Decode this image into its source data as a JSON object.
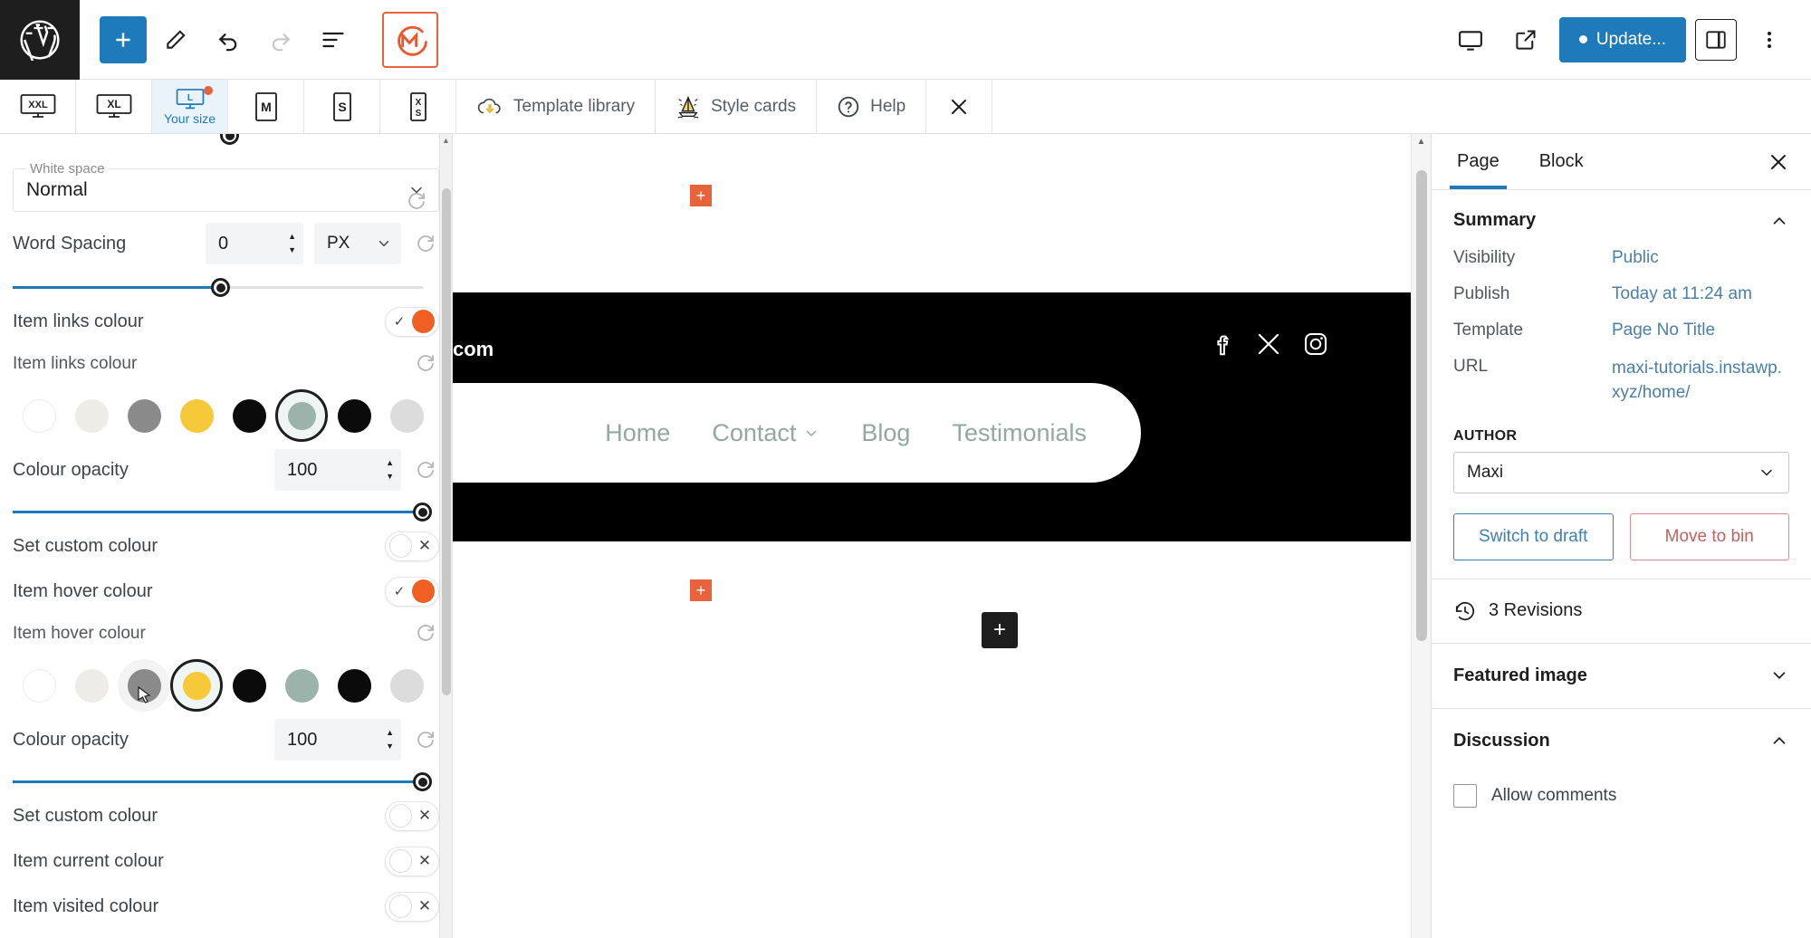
{
  "topbar": {
    "logo_icon": "wordpress-logo-icon",
    "add_block_icon": "plus-icon",
    "edit_icon": "pencil-icon",
    "undo_icon": "undo-arrow-icon",
    "redo_icon": "redo-arrow-icon",
    "list_view_icon": "list-view-icon",
    "maxi_icon": "maxi-blocks-logo-icon",
    "view_icon": "desktop-view-icon",
    "preview_icon": "external-link-icon",
    "update_label": "Update...",
    "settings_icon": "settings-sidebar-icon",
    "options_icon": "kebab-menu-icon"
  },
  "breakpoints": [
    {
      "name": "XXL",
      "label": "",
      "active": false,
      "dot": false
    },
    {
      "name": "XL",
      "label": "",
      "active": false,
      "dot": false
    },
    {
      "name": "L",
      "label": "Your size",
      "active": true,
      "dot": true
    },
    {
      "name": "M",
      "label": "",
      "active": false,
      "dot": false
    },
    {
      "name": "S",
      "label": "",
      "active": false,
      "dot": false
    },
    {
      "name": "XS",
      "label": "",
      "active": false,
      "dot": false
    }
  ],
  "maxi_toolbar": {
    "template_library": "Template library",
    "template_library_icon": "cloud-download-icon",
    "style_cards": "Style cards",
    "style_cards_icon": "sailboat-icon",
    "help": "Help",
    "help_icon": "question-circle-icon",
    "close_icon": "close-x-icon"
  },
  "left_panel": {
    "white_space": {
      "legend": "White space",
      "value": "Normal",
      "caret": "chevron-down-icon"
    },
    "word_spacing": {
      "label": "Word Spacing",
      "value": "0",
      "unit": "PX",
      "reset_icon": "reset-icon"
    },
    "item_links_colour": {
      "toggle_label": "Item links colour",
      "toggle_state": "on",
      "swatch_label": "Item links colour",
      "reset_icon": "reset-icon",
      "swatches": [
        "#ffffff",
        "#eeece6",
        "#8a8a8a",
        "#f5c93a",
        "#0b0b0b",
        "#9bb3ab",
        "#0b0b0b",
        "#dcdcdc"
      ],
      "selected_index": 5,
      "opacity_label": "Colour opacity",
      "opacity_value": "100",
      "custom_label": "Set custom colour",
      "custom_state": "off"
    },
    "item_hover_colour": {
      "toggle_label": "Item hover colour",
      "toggle_state": "on",
      "swatch_label": "Item hover colour",
      "reset_icon": "reset-icon",
      "swatches": [
        "#ffffff",
        "#eeece6",
        "#8a8a8a",
        "#f5c93a",
        "#0b0b0b",
        "#9bb3ab",
        "#0b0b0b",
        "#dcdcdc"
      ],
      "selected_index": 3,
      "hovered_index": 2,
      "opacity_label": "Colour opacity",
      "opacity_value": "100",
      "custom_label": "Set custom colour",
      "custom_state": "off"
    },
    "item_current_colour": {
      "label": "Item current colour",
      "state": "off"
    },
    "item_visited_colour": {
      "label": "Item visited colour",
      "state": "off"
    }
  },
  "canvas": {
    "site_url_text": "com",
    "social_icons": [
      "facebook-icon",
      "x-twitter-icon",
      "instagram-icon"
    ],
    "nav_items": [
      {
        "label": "Home",
        "has_submenu": false
      },
      {
        "label": "Contact",
        "has_submenu": true
      },
      {
        "label": "Blog",
        "has_submenu": false
      },
      {
        "label": "Testimonials",
        "has_submenu": false
      }
    ],
    "nav_colour": "#93a89f",
    "add_block_icon": "plus-icon",
    "inserter_markers": "plus-icon"
  },
  "sidebar": {
    "tabs": [
      {
        "label": "Page",
        "active": true
      },
      {
        "label": "Block",
        "active": false
      }
    ],
    "close_icon": "close-x-icon",
    "summary": {
      "title": "Summary",
      "collapse_icon": "chevron-up-icon",
      "rows": [
        {
          "key": "Visibility",
          "value": "Public"
        },
        {
          "key": "Publish",
          "value": "Today at 11:24 am"
        },
        {
          "key": "Template",
          "value": "Page No Title"
        },
        {
          "key": "URL",
          "value": "maxi-tutorials.instawp.xyz/home/"
        }
      ],
      "author_label": "AUTHOR",
      "author_value": "Maxi",
      "author_caret": "chevron-down-icon",
      "switch_draft": "Switch to draft",
      "move_bin": "Move to bin"
    },
    "revisions": {
      "label": "3 Revisions",
      "icon": "revision-history-icon"
    },
    "featured_image": {
      "label": "Featured image",
      "icon": "chevron-down-icon"
    },
    "discussion": {
      "label": "Discussion",
      "icon": "chevron-up-icon",
      "allow_comments": "Allow comments",
      "allow_comments_checked": false
    }
  },
  "colors": {
    "accent_blue": "#1e7ab8",
    "maxi_orange": "#e8623c",
    "toggle_orange": "#f06023",
    "sage": "#93a89f"
  }
}
